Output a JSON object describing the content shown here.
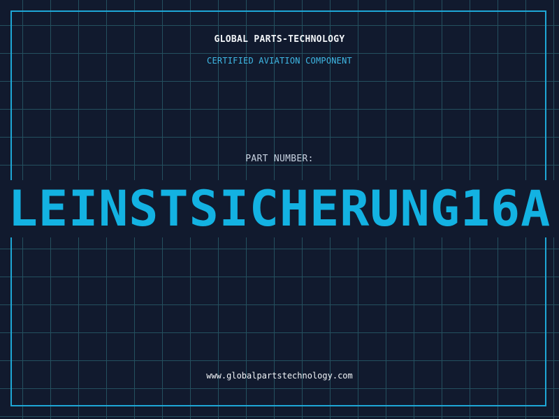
{
  "header": {
    "brand": "GLOBAL PARTS-TECHNOLOGY",
    "subtitle": "CERTIFIED AVIATION COMPONENT"
  },
  "part": {
    "label": "PART NUMBER:",
    "value": "LEINSTSICHERUNG16A"
  },
  "footer": {
    "url": "www.globalpartstechnology.com"
  },
  "colors": {
    "background": "#111a2e",
    "grid": "#24505f",
    "frame": "#1ea7d6",
    "accent": "#13b2e2",
    "text": "#f2f5f8"
  }
}
